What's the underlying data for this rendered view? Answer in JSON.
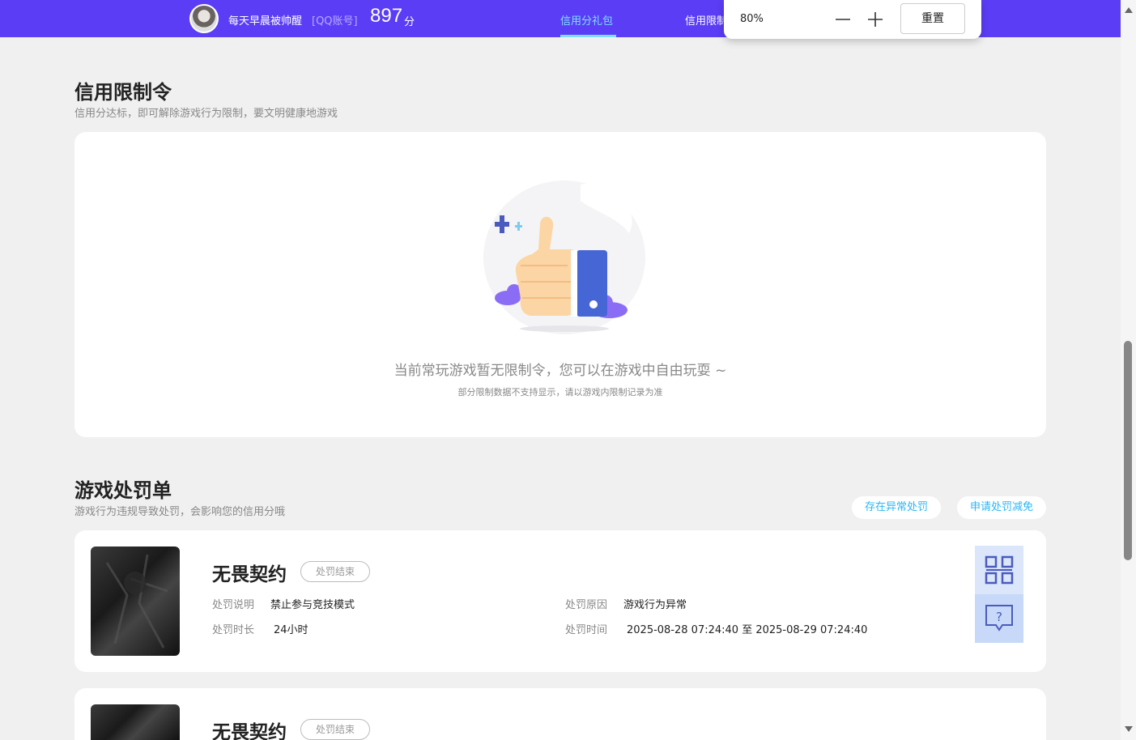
{
  "topbar": {
    "user_name": "每天早晨被帅醒",
    "account_type": "[QQ账号]",
    "score": "897",
    "score_unit": "分",
    "tabs": [
      {
        "label": "信用分礼包",
        "active": true
      },
      {
        "label": "信用限制",
        "active": false
      }
    ]
  },
  "zoom": {
    "value": "80%",
    "minus": "—",
    "plus": "+",
    "reset_label": "重置"
  },
  "restriction": {
    "title": "信用限制令",
    "subtitle": "信用分达标，即可解除游戏行为限制，要文明健康地游戏",
    "empty_message": "当前常玩游戏暂无限制令，您可以在游戏中自由玩耍 ~",
    "empty_note": "部分限制数据不支持显示，请以游戏内限制记录为准"
  },
  "penalty": {
    "title": "游戏处罚单",
    "subtitle": "游戏行为违规导致处罚，会影响您的信用分哦",
    "abnormal_button": "存在异常处罚",
    "reduce_button": "申请处罚减免",
    "items": [
      {
        "game": "无畏契约",
        "status": "处罚结束",
        "desc_label": "处罚说明",
        "desc": "禁止参与竞技模式",
        "duration_label": "处罚时长",
        "duration": "24小时",
        "reason_label": "处罚原因",
        "reason": "游戏行为异常",
        "time_label": "处罚时间",
        "time": "2025-08-28 07:24:40 至 2025-08-29 07:24:40"
      },
      {
        "game": "无畏契约",
        "status": "处罚结束"
      }
    ]
  },
  "colors": {
    "topbar": "#5b3df5",
    "accent": "#7ee0ff",
    "link": "#29b6f6",
    "page_bg": "#f0f0f0"
  },
  "icons": [
    "avatar",
    "thumbs-up-illustration",
    "qr-code-icon",
    "help-chat-icon",
    "scroll-up-arrow",
    "scroll-down-arrow"
  ]
}
